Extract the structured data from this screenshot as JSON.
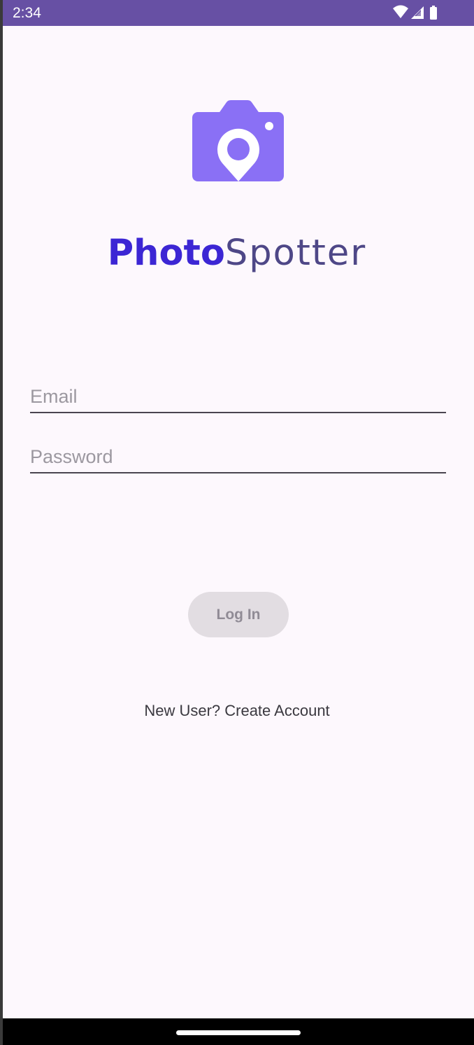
{
  "status_bar": {
    "time": "2:34",
    "background_color": "#6750a4",
    "icons": [
      "wifi-icon",
      "cellular-signal-icon",
      "battery-icon"
    ]
  },
  "logo": {
    "icon": "camera-location-pin-icon",
    "color": "#8a70f5"
  },
  "app_title": {
    "bold_part": "Photo",
    "light_part": "Spotter",
    "bold_color": "#3c26d4",
    "light_color": "#4e4787"
  },
  "form": {
    "email": {
      "placeholder": "Email",
      "value": ""
    },
    "password": {
      "placeholder": "Password",
      "value": ""
    },
    "login_label": "Log In",
    "create_account_label": "New User? Create Account"
  },
  "colors": {
    "background": "#fdf8fd",
    "button_disabled_bg": "#e2dde2",
    "button_disabled_text": "#908b95"
  }
}
